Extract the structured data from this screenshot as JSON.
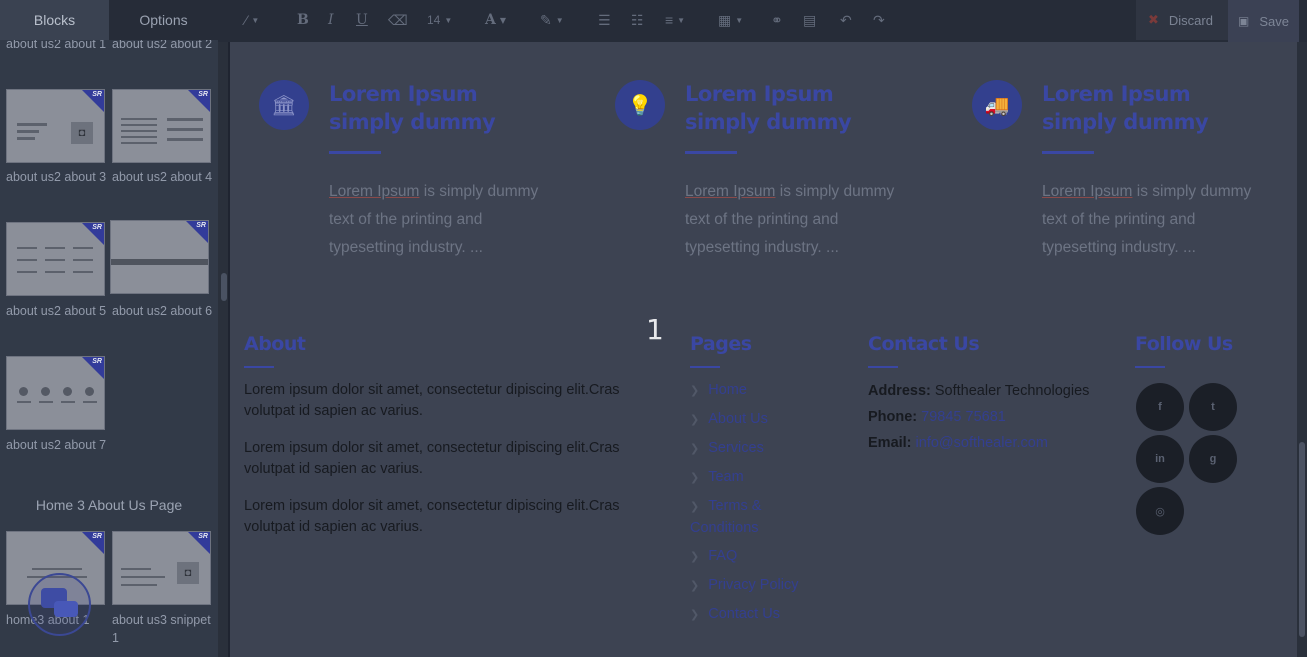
{
  "sidebar": {
    "tabs": [
      "Blocks",
      "Options"
    ],
    "blocks": [
      {
        "label": "about us2 about 1"
      },
      {
        "label": "about us2 about 2"
      },
      {
        "label": "about us2 about 3"
      },
      {
        "label": "about us2 about 4"
      },
      {
        "label": "about us2 about 5"
      },
      {
        "label": "about us2 about 6"
      },
      {
        "label": "about us2 about 7"
      },
      {
        "label": "home3 about 1"
      },
      {
        "label": "about us3 snippet 1"
      }
    ],
    "section_title": "Home 3 About Us Page",
    "thumb_badge": "SR"
  },
  "toolbar": {
    "font_size": "14",
    "discard_label": "Discard",
    "save_label": "Save",
    "icons": [
      "magic-wand-icon",
      "bold-icon",
      "italic-icon",
      "underline-icon",
      "eraser-icon",
      "font-size-icon",
      "font-color-icon",
      "highlight-icon",
      "bullet-list-icon",
      "numbered-list-icon",
      "align-icon",
      "table-icon",
      "link-icon",
      "file-icon",
      "undo-icon",
      "redo-icon"
    ]
  },
  "features": [
    {
      "title": "Lorem Ipsum simply dummy",
      "text_lead": "Lorem Ipsum",
      "text_rest": " is simply dummy text of the printing and typesetting industry. ...",
      "icon": "bank-icon",
      "glyph": "🏛"
    },
    {
      "title": "Lorem Ipsum simply dummy",
      "text_lead": "Lorem Ipsum",
      "text_rest": " is simply dummy text of the printing and typesetting industry. ...",
      "icon": "lightbulb-icon",
      "glyph": "💡"
    },
    {
      "title": "Lorem Ipsum simply dummy",
      "text_lead": "Lorem Ipsum",
      "text_rest": " is simply dummy text of the printing and typesetting industry. ...",
      "icon": "truck-icon",
      "glyph": "🚚"
    }
  ],
  "footer": {
    "about_heading": "About",
    "about_paragraphs": [
      "Lorem ipsum dolor sit amet, consectetur dipiscing elit.Cras volutpat id sapien ac varius.",
      "Lorem ipsum dolor sit amet, consectetur dipiscing elit.Cras volutpat id sapien ac varius.",
      "Lorem ipsum dolor sit amet, consectetur dipiscing elit.Cras volutpat id sapien ac varius."
    ],
    "pages_heading": "Pages",
    "pages": [
      "Home",
      "About Us",
      "Services",
      "Team",
      "Terms & Conditions",
      "FAQ",
      "Privacy Policy",
      "Contact Us"
    ],
    "contact_heading": "Contact Us",
    "contact": {
      "address_label": "Address:",
      "address_value": "Softhealer Technologies",
      "phone_label": "Phone:",
      "phone_value": "79845 75681",
      "email_label": "Email:",
      "email_value": "info@softhealer.com"
    },
    "follow_heading": "Follow Us",
    "social": [
      {
        "icon": "facebook-icon",
        "glyph": "f"
      },
      {
        "icon": "twitter-icon",
        "glyph": "t"
      },
      {
        "icon": "linkedin-icon",
        "glyph": "in"
      },
      {
        "icon": "github-icon",
        "glyph": "g"
      },
      {
        "icon": "instagram-icon",
        "glyph": "◎"
      }
    ]
  },
  "drop_badge": "1",
  "colors": {
    "accent": "#3a47a3",
    "discard_icon": "#7a3a3a"
  }
}
